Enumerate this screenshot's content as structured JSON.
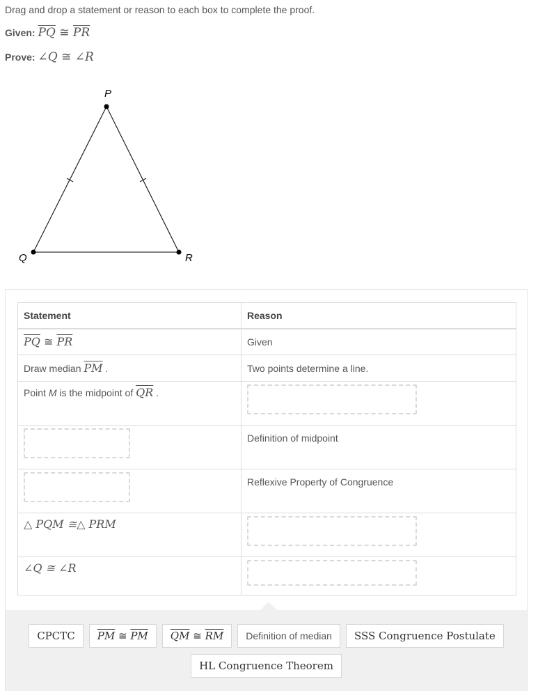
{
  "instructions": "Drag and drop a statement or reason to each box to complete the proof.",
  "given": {
    "label": "Given:",
    "left": "PQ",
    "symbol": "≅",
    "right": "PR"
  },
  "prove": {
    "label": "Prove:",
    "left": "∠Q",
    "symbol": "≅",
    "right": "∠R"
  },
  "figure": {
    "vertices": {
      "P": "P",
      "Q": "Q",
      "R": "R"
    },
    "tick_marks": [
      "PQ",
      "PR"
    ]
  },
  "proof_table": {
    "headers": {
      "statement": "Statement",
      "reason": "Reason"
    },
    "rows": [
      {
        "statement": {
          "type": "math",
          "a": "PQ",
          "sym": "≅",
          "b": "PR"
        },
        "reason": {
          "type": "text",
          "text": "Given"
        }
      },
      {
        "statement": {
          "type": "mixed",
          "prefix": "Draw median ",
          "seg": "PM",
          "suffix": " ."
        },
        "reason": {
          "type": "text",
          "text": "Two points determine a line."
        }
      },
      {
        "statement": {
          "type": "mixed",
          "prefix": "Point ",
          "var": "M",
          "middle": " is the midpoint of ",
          "seg": "QR",
          "suffix": " ."
        },
        "reason": {
          "type": "dropzone"
        }
      },
      {
        "statement": {
          "type": "dropzone"
        },
        "reason": {
          "type": "text",
          "text": "Definition of midpoint"
        }
      },
      {
        "statement": {
          "type": "dropzone"
        },
        "reason": {
          "type": "text",
          "text": "Reflexive Property of Congruence"
        }
      },
      {
        "statement": {
          "type": "math",
          "text": "△ PQM ≅△ PRM"
        },
        "reason": {
          "type": "dropzone"
        }
      },
      {
        "statement": {
          "type": "math",
          "text": "∠Q ≅ ∠R"
        },
        "reason": {
          "type": "dropzone"
        }
      }
    ]
  },
  "answer_bank": {
    "tiles": [
      {
        "label": "CPCTC"
      },
      {
        "a": "PM",
        "sym": "≅",
        "b": "PM"
      },
      {
        "a": "QM",
        "sym": "≅",
        "b": "RM"
      },
      {
        "label": "Definition of median"
      },
      {
        "label": "SSS Congruence Postulate"
      },
      {
        "label": "HL Congruence Theorem"
      }
    ]
  }
}
